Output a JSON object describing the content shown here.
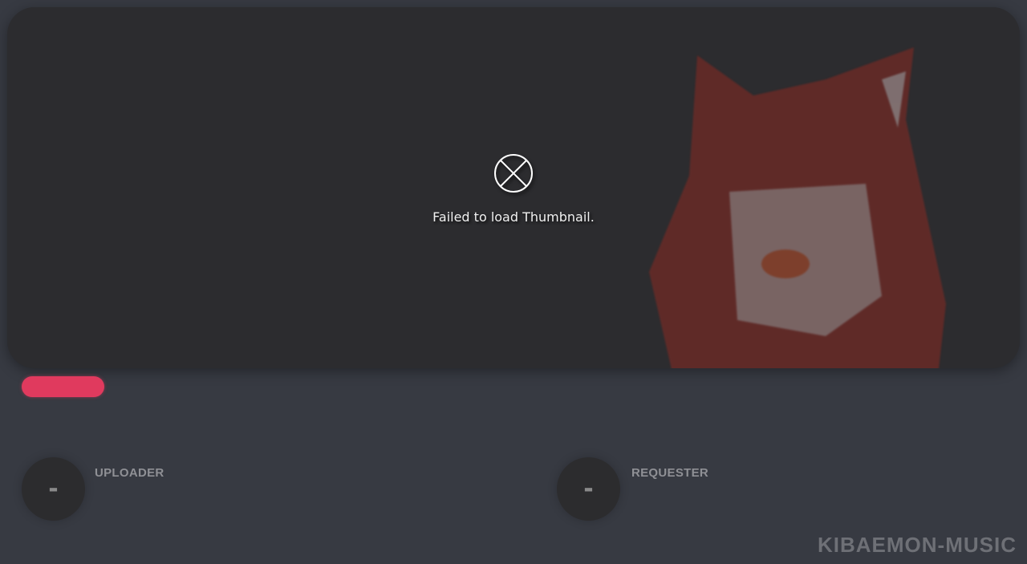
{
  "thumbnail": {
    "error_icon": "circle-x-icon",
    "error_text": "Failed to load Thumbnail."
  },
  "progress": {
    "color": "#e03a5e"
  },
  "uploader": {
    "label": "UPLOADER",
    "value": "-"
  },
  "requester": {
    "label": "REQUESTER",
    "value": "-"
  },
  "brand": {
    "logo": "KIBAEMON-MUSIC"
  }
}
